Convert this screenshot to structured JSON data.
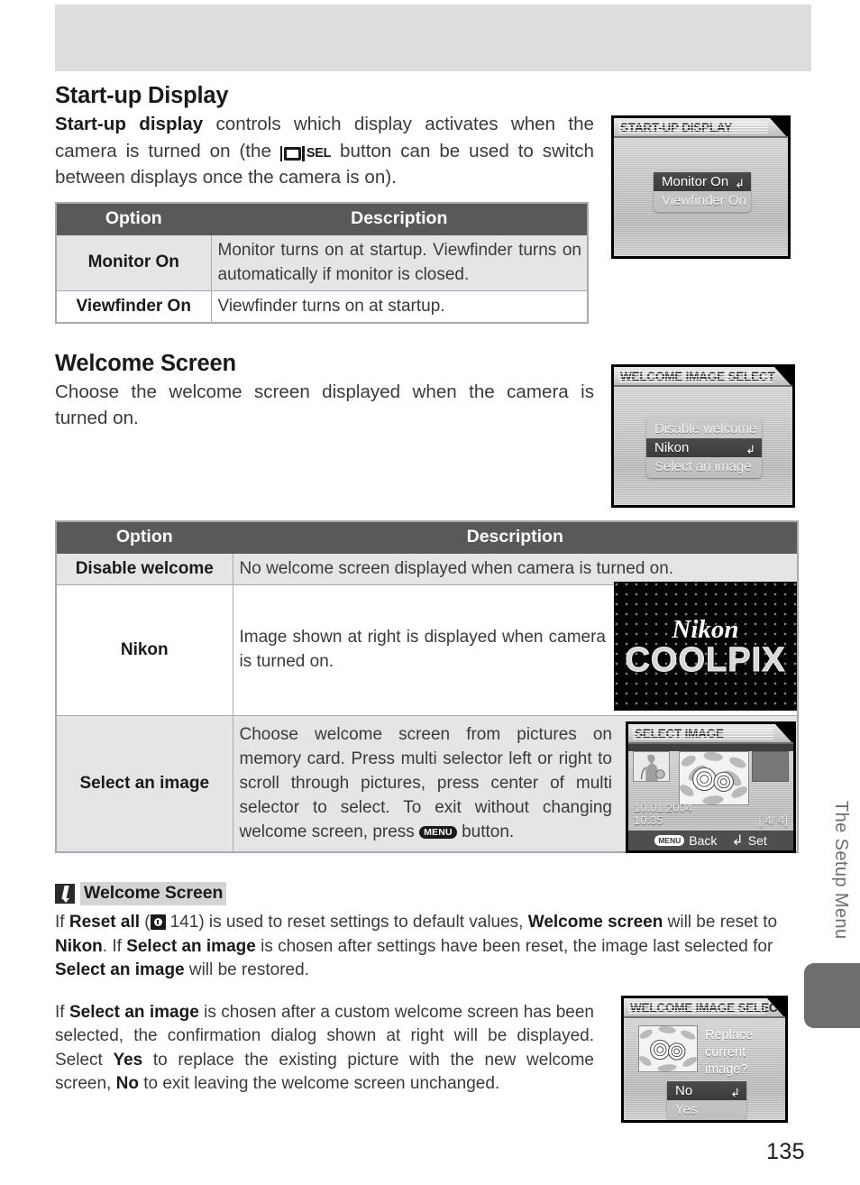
{
  "page": {
    "number": "135",
    "side_tab": "The Setup Menu"
  },
  "sections": {
    "startup": {
      "heading": "Start-up Display",
      "intro_lead": "Start-up display",
      "intro_rest_1": " controls which display activates when the camera is turned on (the ",
      "intro_icon": "monitor-sel-button-icon",
      "intro_sel_label": "SEL",
      "intro_rest_2": " button can be used to switch between displays once the camera is on)."
    },
    "welcome": {
      "heading": "Welcome Screen",
      "intro": "Choose the welcome screen displayed when the camera is turned on."
    }
  },
  "table_startup": {
    "headers": [
      "Option",
      "Description"
    ],
    "rows": [
      {
        "option": "Monitor On",
        "description": "Monitor turns on at startup.  Viewfinder turns on automatically if monitor is closed.",
        "shade": true
      },
      {
        "option": "Viewfinder On",
        "description": "Viewfinder turns on at startup.",
        "shade": false
      }
    ]
  },
  "table_welcome": {
    "headers": [
      "Option",
      "Description"
    ],
    "rows": [
      {
        "option": "Disable welcome",
        "description": "No welcome screen displayed when camera is turned on.",
        "shade": true
      },
      {
        "option": "Nikon",
        "description": "Image shown at right is displayed when camera is turned on.",
        "shade": false
      },
      {
        "option": "Select an image",
        "description_1": "Choose welcome screen from pictures on memory card.  Press multi selector left or right to scroll through pictures, press center of multi selector to select.  To exit without changing welcome screen, press ",
        "description_menu_icon": "MENU",
        "description_2": " button.",
        "shade": true
      }
    ]
  },
  "lcd_startup": {
    "title": "START-UP DISPLAY",
    "items": [
      {
        "label": "Monitor On",
        "selected": true,
        "enter_mark": "↲"
      },
      {
        "label": "Viewfinder On",
        "selected": false,
        "enter_mark": ""
      }
    ]
  },
  "lcd_welcome": {
    "title": "WELCOME IMAGE SELECT",
    "items": [
      {
        "label": "Disable welcome",
        "selected": false,
        "enter_mark": ""
      },
      {
        "label": "Nikon",
        "selected": true,
        "enter_mark": "↲"
      },
      {
        "label": "Select an image",
        "selected": false,
        "enter_mark": ""
      }
    ]
  },
  "splash": {
    "brand": "Nikon",
    "product": "COOLPIX"
  },
  "lcd_select_image": {
    "title": "SELECT IMAGE",
    "date": "10.01.2004",
    "time": "10:35",
    "counter": "[    4/   4]",
    "back_icon": "MENU",
    "back_label": "Back",
    "set_icon": "↲",
    "set_label": "Set"
  },
  "lcd_confirm": {
    "title": "WELCOME IMAGE SELECT",
    "message": "Replace current image?",
    "items": [
      {
        "label": "No",
        "selected": true,
        "enter_mark": "↲"
      },
      {
        "label": "Yes",
        "selected": false,
        "enter_mark": ""
      }
    ]
  },
  "note": {
    "icon": "pencil-icon",
    "title": "Welcome Screen",
    "p1_a": "If ",
    "p1_b": "Reset all",
    "p1_c": " (",
    "p1_ref": "141",
    "p1_d": ") is used to reset settings to default values, ",
    "p1_e": "Welcome screen",
    "p1_f": " will be reset to ",
    "p1_g": "Nikon",
    "p1_h": ".  If ",
    "p1_i": "Select an image",
    "p1_j": " is chosen after settings have been reset, the image last selected for ",
    "p1_k": "Select an image",
    "p1_l": " will be restored.",
    "p2_a": "If ",
    "p2_b": "Select an image",
    "p2_c": " is chosen after a custom welcome screen has been selected, the confirmation dialog shown at right will be displayed.  Select ",
    "p2_d": "Yes",
    "p2_e": " to replace the existing picture with the new welcome screen, ",
    "p2_f": "No",
    "p2_g": " to exit leaving the welcome screen unchanged."
  }
}
